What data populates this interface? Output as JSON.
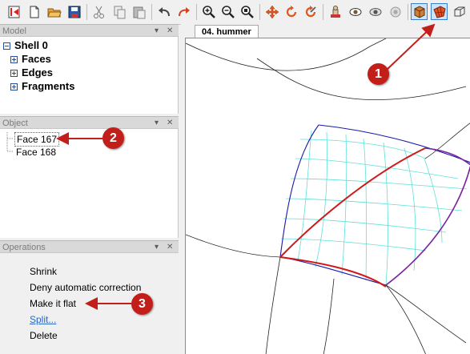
{
  "toolbar": {
    "buttons": [
      {
        "name": "exit-icon"
      },
      {
        "name": "new-document-icon"
      },
      {
        "name": "open-folder-icon"
      },
      {
        "name": "save-icon"
      },
      {
        "name": "cut-icon"
      },
      {
        "name": "copy-icon"
      },
      {
        "name": "paste-icon"
      },
      {
        "name": "undo-icon"
      },
      {
        "name": "redo-icon"
      },
      {
        "name": "zoom-in-icon"
      },
      {
        "name": "zoom-out-icon"
      },
      {
        "name": "zoom-fit-icon"
      },
      {
        "name": "pan-icon"
      },
      {
        "name": "rotate-icon"
      },
      {
        "name": "rotate-free-icon"
      },
      {
        "name": "stamp-icon"
      },
      {
        "name": "eye-icon"
      },
      {
        "name": "eye-settings-icon"
      },
      {
        "name": "eye-disabled-icon"
      },
      {
        "name": "box-view-icon"
      },
      {
        "name": "surface-view-icon"
      },
      {
        "name": "wireframe-view-icon"
      }
    ]
  },
  "model_panel": {
    "title": "Model",
    "tree": {
      "root": "Shell 0",
      "children": [
        "Faces",
        "Edges",
        "Fragments"
      ]
    }
  },
  "object_panel": {
    "title": "Object",
    "items": [
      "Face 167",
      "Face 168"
    ]
  },
  "operations_panel": {
    "title": "Operations",
    "items": [
      "Shrink",
      "Deny automatic correction",
      "Make it flat",
      "Split...",
      "Delete"
    ]
  },
  "viewport": {
    "tab_label": "04. hummer"
  },
  "callouts": [
    "1",
    "2",
    "3"
  ],
  "colors": {
    "callout": "#c31f1a",
    "surface_boundary": "#1a1aa8",
    "mesh": "#5fe0d8",
    "selected_edge": "#d01818",
    "edge_purple": "#7a22a0"
  }
}
